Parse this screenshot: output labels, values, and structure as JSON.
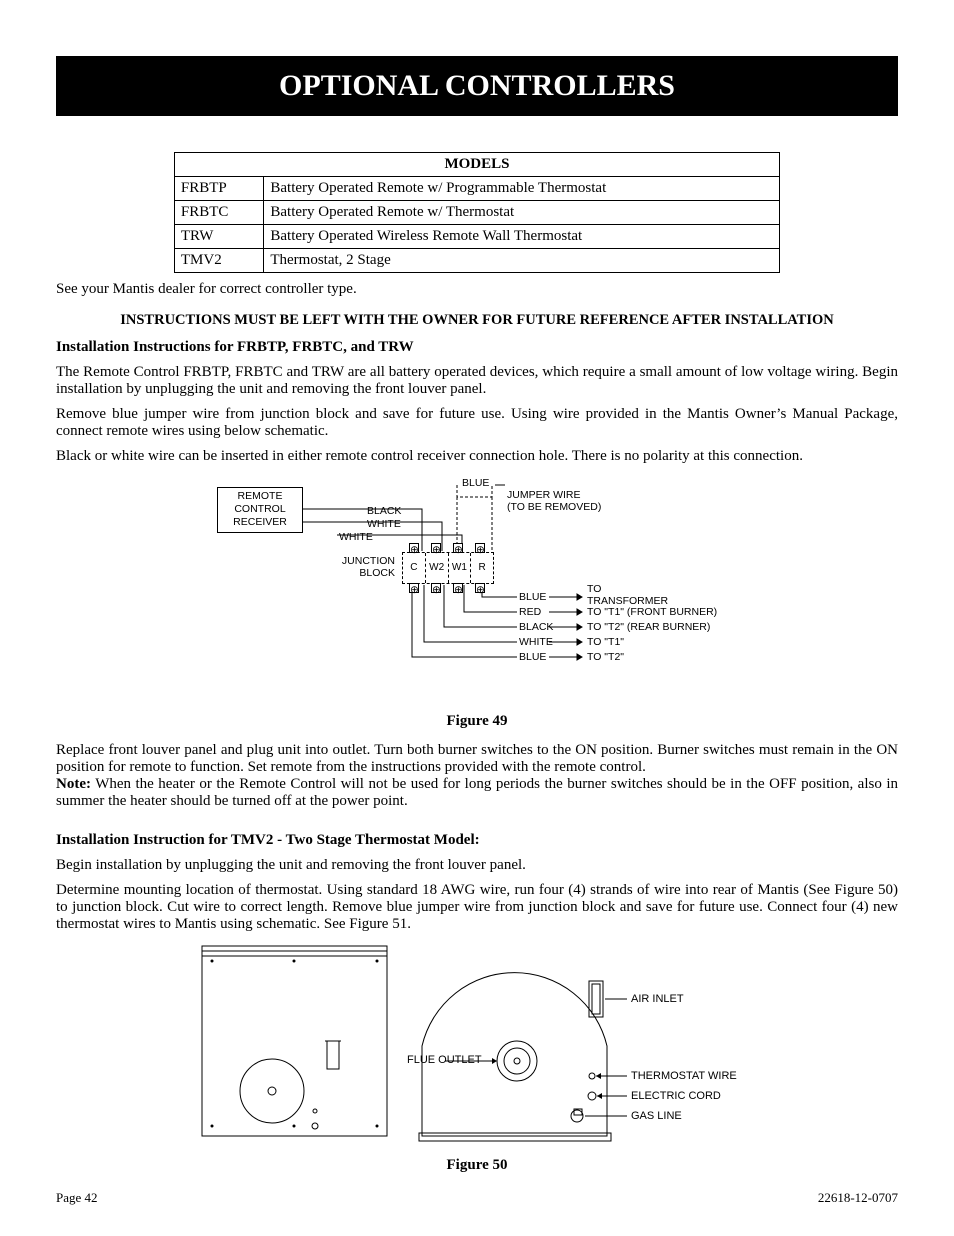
{
  "title": "OPTIONAL CONTROLLERS",
  "models_header": "MODELS",
  "models": [
    {
      "code": "FRBTP",
      "desc": "Battery Operated Remote w/ Programmable Thermostat"
    },
    {
      "code": "FRBTC",
      "desc": "Battery Operated Remote w/ Thermostat"
    },
    {
      "code": "TRW",
      "desc": "Battery Operated Wireless Remote Wall Thermostat"
    },
    {
      "code": "TMV2",
      "desc": "Thermostat, 2 Stage"
    }
  ],
  "see_dealer": "See your Mantis dealer for correct controller type.",
  "instr_banner": "INSTRUCTIONS MUST BE LEFT WITH THE OWNER FOR FUTURE REFERENCE AFTER INSTALLATION",
  "sec1_heading": "Installation Instructions for FRBTP, FRBTC, and TRW",
  "sec1_p1": "The Remote Control FRBTP, FRBTC and TRW are all battery operated devices, which require a small amount of low voltage wiring.  Begin installation by unplugging the unit and removing the front louver panel.",
  "sec1_p2": "Remove blue jumper wire from junction block and save for future use.  Using wire provided in the Mantis Owner’s Manual Package, connect remote wires using below schematic.",
  "sec1_p3": "Black or white wire can be inserted in either remote control receiver connection hole. There is no polarity at this connection.",
  "fig49": {
    "caption": "Figure 49",
    "receiver": "REMOTE\nCONTROL\nRECEIVER",
    "junction_block": "JUNCTION\nBLOCK",
    "terminals": [
      "C",
      "W2",
      "W1",
      "R"
    ],
    "top_labels": {
      "blue": "BLUE",
      "jumper": "JUMPER WIRE",
      "jumper2": "(TO BE REMOVED)",
      "black": "BLACK",
      "white": "WHITE",
      "white2": "WHITE"
    },
    "bottom_wires": [
      {
        "color": "BLUE",
        "dest": "TO\nTRANSFORMER"
      },
      {
        "color": "RED",
        "dest": "TO \"T1\" (FRONT BURNER)"
      },
      {
        "color": "BLACK",
        "dest": "TO \"T2\" (REAR BURNER)"
      },
      {
        "color": "WHITE",
        "dest": "TO \"T1\""
      },
      {
        "color": "BLUE",
        "dest": "TO \"T2\""
      }
    ]
  },
  "sec1_p4": "Replace front louver panel and plug unit into outlet.  Turn both burner switches to the ON position.  Burner switches must remain in the ON position for remote to function.  Set remote from the instructions provided with the remote control.",
  "note_label": "Note:",
  "sec1_note": "  When the heater or the Remote Control will not be used for long periods the burner switches should be in the OFF position, also in summer the heater should be turned off at the power point.",
  "sec2_heading": "Installation Instruction for TMV2 - Two Stage Thermostat Model:",
  "sec2_p1": "Begin installation by unplugging the unit and removing the front louver panel.",
  "sec2_p2": "Determine mounting location of thermostat.  Using standard 18 AWG wire, run four (4) strands of wire into rear of Mantis (See Figure 50) to junction block.  Cut wire to correct length.  Remove blue jumper wire from junction block and save for future use.  Connect four (4) new thermostat wires to Mantis using schematic. See Figure 51.",
  "fig50": {
    "caption": "Figure 50",
    "flue_outlet": "FLUE OUTLET",
    "air_inlet": "AIR INLET",
    "thermostat_wire": "THERMOSTAT WIRE",
    "electric_cord": "ELECTRIC CORD",
    "gas_line": "GAS LINE"
  },
  "footer_left": "Page 42",
  "footer_right": "22618-12-0707"
}
